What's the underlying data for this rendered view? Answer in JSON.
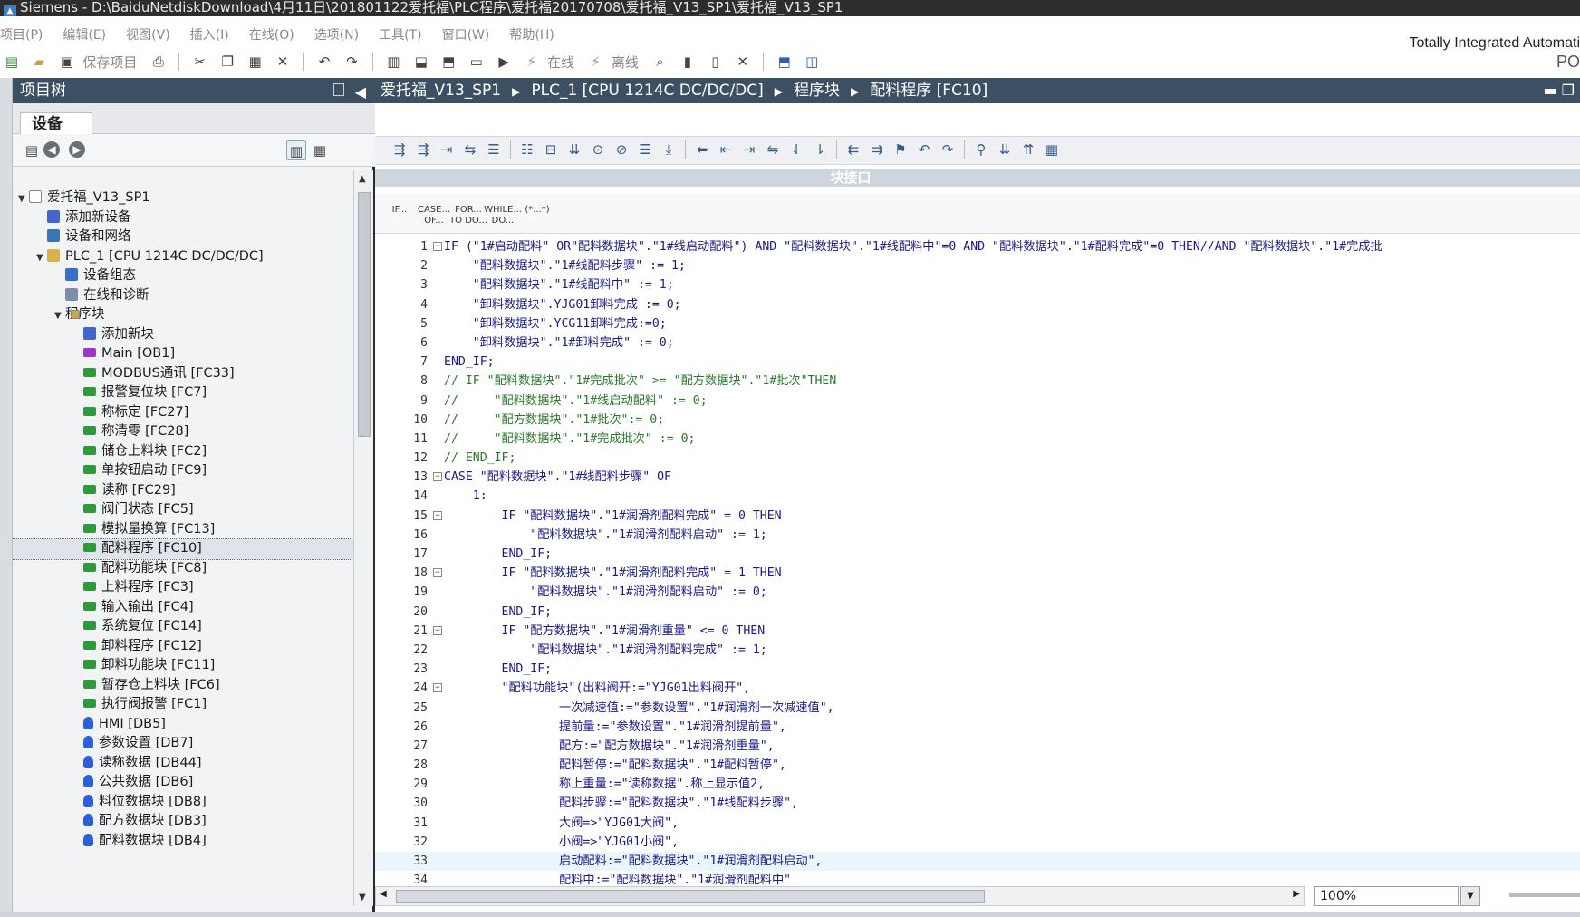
{
  "window": {
    "title": "Siemens  -  D:\\BaiduNetdiskDownload\\4月11日\\201801122爱托福\\PLC程序\\爱托福20170708\\爱托福_V13_SP1\\爱托福_V13_SP1"
  },
  "menu": [
    "项目(P)",
    "编辑(E)",
    "视图(V)",
    "插入(I)",
    "在线(O)",
    "选项(N)",
    "工具(T)",
    "窗口(W)",
    "帮助(H)"
  ],
  "brand": {
    "line1": "Totally Integrated Automati",
    "line2": "PO"
  },
  "toolbar": {
    "save_label": "保存项目",
    "online_label": "在线",
    "offline_label": "离线"
  },
  "project_tree": {
    "title": "项目树",
    "tab": "设备",
    "items": [
      {
        "label": "爱托福_V13_SP1",
        "icon": "project-icon",
        "level": 0,
        "twisty": "▼"
      },
      {
        "label": "添加新设备",
        "icon": "add-device-icon",
        "level": 1,
        "twisty": ""
      },
      {
        "label": "设备和网络",
        "icon": "network-icon",
        "level": 1,
        "twisty": ""
      },
      {
        "label": "PLC_1 [CPU 1214C DC/DC/DC]",
        "icon": "plc-icon",
        "level": 1,
        "twisty": "▼"
      },
      {
        "label": "设备组态",
        "icon": "device-config-icon",
        "level": 2,
        "twisty": ""
      },
      {
        "label": "在线和诊断",
        "icon": "diagnostics-icon",
        "level": 2,
        "twisty": ""
      },
      {
        "label": "程序块",
        "icon": "folder-icon",
        "level": 2,
        "twisty": "▼"
      },
      {
        "label": "添加新块",
        "icon": "add-block-icon",
        "level": 3,
        "twisty": ""
      },
      {
        "label": "Main [OB1]",
        "icon": "ob-block-icon",
        "level": 3,
        "twisty": ""
      },
      {
        "label": "MODBUS通讯 [FC33]",
        "icon": "fc-block-icon",
        "level": 3,
        "twisty": ""
      },
      {
        "label": "报警复位块 [FC7]",
        "icon": "fc-block-icon",
        "level": 3,
        "twisty": ""
      },
      {
        "label": "称标定 [FC27]",
        "icon": "fc-block-icon",
        "level": 3,
        "twisty": ""
      },
      {
        "label": "称清零 [FC28]",
        "icon": "fc-block-icon",
        "level": 3,
        "twisty": ""
      },
      {
        "label": "储仓上料块 [FC2]",
        "icon": "fc-block-icon",
        "level": 3,
        "twisty": ""
      },
      {
        "label": "单按钮启动 [FC9]",
        "icon": "fc-block-icon",
        "level": 3,
        "twisty": ""
      },
      {
        "label": "读称 [FC29]",
        "icon": "fc-block-icon",
        "level": 3,
        "twisty": ""
      },
      {
        "label": "阀门状态 [FC5]",
        "icon": "fc-block-icon",
        "level": 3,
        "twisty": ""
      },
      {
        "label": "模拟量换算 [FC13]",
        "icon": "fc-block-icon",
        "level": 3,
        "twisty": ""
      },
      {
        "label": "配料程序 [FC10]",
        "icon": "fc-block-icon",
        "level": 3,
        "twisty": "",
        "selected": true
      },
      {
        "label": "配料功能块 [FC8]",
        "icon": "fc-block-icon",
        "level": 3,
        "twisty": ""
      },
      {
        "label": "上料程序 [FC3]",
        "icon": "fc-block-icon",
        "level": 3,
        "twisty": ""
      },
      {
        "label": "输入输出 [FC4]",
        "icon": "fc-block-icon",
        "level": 3,
        "twisty": ""
      },
      {
        "label": "系统复位 [FC14]",
        "icon": "fc-block-icon",
        "level": 3,
        "twisty": ""
      },
      {
        "label": "卸料程序 [FC12]",
        "icon": "fc-block-icon",
        "level": 3,
        "twisty": ""
      },
      {
        "label": "卸料功能块 [FC11]",
        "icon": "fc-block-icon",
        "level": 3,
        "twisty": ""
      },
      {
        "label": "暂存仓上料块 [FC6]",
        "icon": "fc-block-icon",
        "level": 3,
        "twisty": ""
      },
      {
        "label": "执行阀报警 [FC1]",
        "icon": "fc-block-icon",
        "level": 3,
        "twisty": ""
      },
      {
        "label": "HMI [DB5]",
        "icon": "db-block-icon",
        "level": 3,
        "twisty": ""
      },
      {
        "label": "参数设置 [DB7]",
        "icon": "db-block-icon",
        "level": 3,
        "twisty": ""
      },
      {
        "label": "读称数据 [DB44]",
        "icon": "db-block-icon",
        "level": 3,
        "twisty": ""
      },
      {
        "label": "公共数据 [DB6]",
        "icon": "db-block-icon",
        "level": 3,
        "twisty": ""
      },
      {
        "label": "料位数据块 [DB8]",
        "icon": "db-block-icon",
        "level": 3,
        "twisty": ""
      },
      {
        "label": "配方数据块 [DB3]",
        "icon": "db-block-icon",
        "level": 3,
        "twisty": ""
      },
      {
        "label": "配料数据块 [DB4]",
        "icon": "db-block-icon",
        "level": 3,
        "twisty": ""
      }
    ]
  },
  "breadcrumb": [
    "爱托福_V13_SP1",
    "PLC_1 [CPU 1214C DC/DC/DC]",
    "程序块",
    "配料程序 [FC10]"
  ],
  "editor": {
    "interface_label": "块接口",
    "snippets": [
      {
        "l1": "IF...",
        "l2": ""
      },
      {
        "l1": "CASE...",
        "l2": "OF..."
      },
      {
        "l1": "FOR...",
        "l2": "TO DO..."
      },
      {
        "l1": "WHILE...",
        "l2": "DO..."
      },
      {
        "l1": "(*...*)",
        "l2": ""
      }
    ],
    "zoom": "100%",
    "code_lines": [
      {
        "n": "1",
        "fold": "⊟",
        "t": "IF (\"1#启动配料\" OR\"配料数据块\".\"1#线启动配料\") AND \"配料数据块\".\"1#线配料中\"=0 AND \"配料数据块\".\"1#配料完成\"=0 THEN//AND \"配料数据块\".\"1#完成批"
      },
      {
        "n": "2",
        "fold": "",
        "t": "    \"配料数据块\".\"1#线配料步骤\" := 1;"
      },
      {
        "n": "3",
        "fold": "",
        "t": "    \"配料数据块\".\"1#线配料中\" := 1;"
      },
      {
        "n": "4",
        "fold": "",
        "t": "    \"卸料数据块\".YJG01卸料完成 := 0;"
      },
      {
        "n": "5",
        "fold": "",
        "t": "    \"卸料数据块\".YCG11卸料完成:=0;"
      },
      {
        "n": "6",
        "fold": "",
        "t": "    \"卸料数据块\".\"1#卸料完成\" := 0;"
      },
      {
        "n": "7",
        "fold": "",
        "t": "END_IF;"
      },
      {
        "n": "8",
        "fold": "",
        "t": "// IF \"配料数据块\".\"1#完成批次\" >= \"配方数据块\".\"1#批次\"THEN",
        "c": true
      },
      {
        "n": "9",
        "fold": "",
        "t": "//     \"配料数据块\".\"1#线启动配料\" := 0;",
        "c": true
      },
      {
        "n": "10",
        "fold": "",
        "t": "//     \"配方数据块\".\"1#批次\":= 0;",
        "c": true
      },
      {
        "n": "11",
        "fold": "",
        "t": "//     \"配料数据块\".\"1#完成批次\" := 0;",
        "c": true
      },
      {
        "n": "12",
        "fold": "",
        "t": "// END_IF;",
        "c": true
      },
      {
        "n": "13",
        "fold": "⊟",
        "t": "CASE \"配料数据块\".\"1#线配料步骤\" OF"
      },
      {
        "n": "14",
        "fold": "",
        "t": "    1:"
      },
      {
        "n": "15",
        "fold": "⊟",
        "t": "        IF \"配料数据块\".\"1#润滑剂配料完成\" = 0 THEN"
      },
      {
        "n": "16",
        "fold": "",
        "t": "            \"配料数据块\".\"1#润滑剂配料启动\" := 1;"
      },
      {
        "n": "17",
        "fold": "",
        "t": "        END_IF;"
      },
      {
        "n": "18",
        "fold": "⊟",
        "t": "        IF \"配料数据块\".\"1#润滑剂配料完成\" = 1 THEN"
      },
      {
        "n": "19",
        "fold": "",
        "t": "            \"配料数据块\".\"1#润滑剂配料启动\" := 0;"
      },
      {
        "n": "20",
        "fold": "",
        "t": "        END_IF;"
      },
      {
        "n": "21",
        "fold": "⊟",
        "t": "        IF \"配方数据块\".\"1#润滑剂重量\" <= 0 THEN"
      },
      {
        "n": "22",
        "fold": "",
        "t": "            \"配料数据块\".\"1#润滑剂配料完成\" := 1;"
      },
      {
        "n": "23",
        "fold": "",
        "t": "        END_IF;"
      },
      {
        "n": "24",
        "fold": "⊟",
        "t": "        \"配料功能块\"(出料阀开:=\"YJG01出料阀开\","
      },
      {
        "n": "25",
        "fold": "",
        "t": "                一次减速值:=\"参数设置\".\"1#润滑剂一次减速值\","
      },
      {
        "n": "26",
        "fold": "",
        "t": "                提前量:=\"参数设置\".\"1#润滑剂提前量\","
      },
      {
        "n": "27",
        "fold": "",
        "t": "                配方:=\"配方数据块\".\"1#润滑剂重量\","
      },
      {
        "n": "28",
        "fold": "",
        "t": "                配料暂停:=\"配料数据块\".\"1#配料暂停\","
      },
      {
        "n": "29",
        "fold": "",
        "t": "                称上重量:=\"读称数据\".称上显示值2,"
      },
      {
        "n": "30",
        "fold": "",
        "t": "                配料步骤:=\"配料数据块\".\"1#线配料步骤\","
      },
      {
        "n": "31",
        "fold": "",
        "t": "                大阀=>\"YJG01大阀\","
      },
      {
        "n": "32",
        "fold": "",
        "t": "                小阀=>\"YJG01小阀\","
      },
      {
        "n": "33",
        "fold": "",
        "t": "                启动配料:=\"配料数据块\".\"1#润滑剂配料启动\",",
        "hl": true
      },
      {
        "n": "34",
        "fold": "",
        "t": "                配料中:=\"配料数据块\".\"1#润滑剂配料中\""
      }
    ]
  }
}
